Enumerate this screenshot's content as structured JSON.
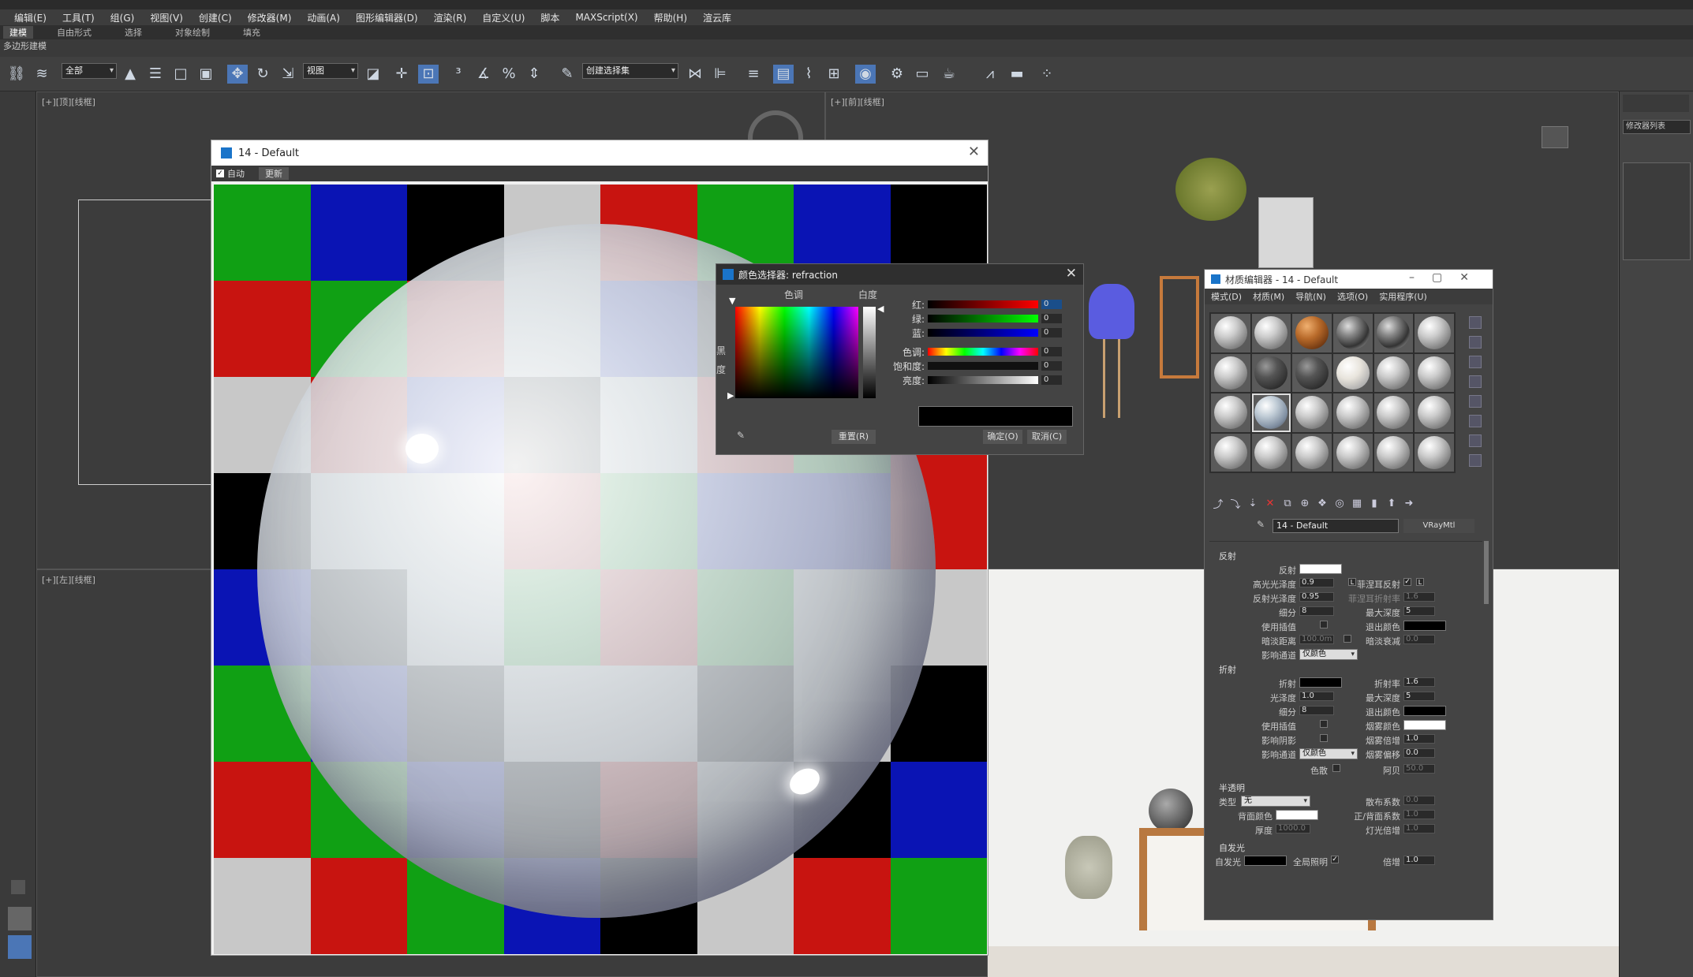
{
  "menu": [
    "编辑(E)",
    "工具(T)",
    "组(G)",
    "视图(V)",
    "创建(C)",
    "修改器(M)",
    "动画(A)",
    "图形编辑器(D)",
    "渲染(R)",
    "自定义(U)",
    "脚本",
    "MAXScript(X)",
    "帮助(H)",
    "渲云库"
  ],
  "ribbon": [
    "建模",
    "自由形式",
    "选择",
    "对象绘制",
    "填充"
  ],
  "ribbon_sub": "多边形建模",
  "toolbar": {
    "select_filter": "全部",
    "coord_system": "视图",
    "selection_set": "创建选择集"
  },
  "viewports": {
    "top_left": "[+][顶][线框]",
    "top_right": "[+][前][线框]",
    "bottom_left": "[+][左][线框]"
  },
  "right_panel": {
    "modifier_list": "修改器列表"
  },
  "material_preview": {
    "title": "14 - Default",
    "auto_label": "自动",
    "update_label": "更新",
    "checker_colors": [
      [
        "#10a014",
        "#0a14b4",
        "#000000",
        "#c8c8c8",
        "#c81410",
        "#10a014",
        "#0a14b4",
        "#000000"
      ],
      [
        "#c81410",
        "#10a014",
        "#c81410",
        "#c8c8c8",
        "#0a14b4",
        "#000000",
        "#c8c8c8",
        "#c81410"
      ],
      [
        "#c8c8c8",
        "#c81410",
        "#0a14b4",
        "#000000",
        "#c8c8c8",
        "#c81410",
        "#10a014",
        "#c81410"
      ],
      [
        "#000000",
        "#c8c8c8",
        "#c8c8c8",
        "#c81410",
        "#10a014",
        "#0a14b4",
        "#0a14b4",
        "#c81410"
      ],
      [
        "#0a14b4",
        "#000000",
        "#c8c8c8",
        "#10a014",
        "#c81410",
        "#10a014",
        "#c8c8c8",
        "#c8c8c8"
      ],
      [
        "#10a014",
        "#0a14b4",
        "#000000",
        "#c8c8c8",
        "#c8c8c8",
        "#000000",
        "#c8c8c8",
        "#000000"
      ],
      [
        "#c81410",
        "#10a014",
        "#0a14b4",
        "#000000",
        "#c81410",
        "#c8c8c8",
        "#000000",
        "#0a14b4"
      ],
      [
        "#c8c8c8",
        "#c81410",
        "#10a014",
        "#0a14b4",
        "#000000",
        "#c8c8c8",
        "#c81410",
        "#10a014"
      ]
    ]
  },
  "color_picker": {
    "title": "颜色选择器: refraction",
    "hue_label": "色调",
    "whiteness_label": "白度",
    "blackness_label": "黑度",
    "red_label": "红:",
    "green_label": "绿:",
    "blue_label": "蓝:",
    "hue2_label": "色调:",
    "saturation_label": "饱和度:",
    "value_label": "亮度:",
    "red": "0",
    "green": "0",
    "blue": "0",
    "hue": "0",
    "saturation": "0",
    "value": "0",
    "reset_label": "重置(R)",
    "ok_label": "确定(O)",
    "cancel_label": "取消(C)",
    "current_color": "#000000"
  },
  "material_editor": {
    "title": "材质编辑器 - 14 - Default",
    "menu": [
      "模式(D)",
      "材质(M)",
      "导航(N)",
      "选项(O)",
      "实用程序(U)"
    ],
    "material_name": "14 - Default",
    "material_type": "VRayMtl",
    "reflection": {
      "section": "反射",
      "reflect_label": "反射",
      "hilight_gloss_label": "高光光泽度",
      "hilight_gloss": "0.9",
      "lock_label": "L",
      "refl_gloss_label": "反射光泽度",
      "refl_gloss": "0.95",
      "subdivs_label": "细分",
      "subdivs": "8",
      "use_interp_label": "使用插值",
      "dim_distance_label": "暗淡距离",
      "dim_distance": "100.0m",
      "affect_channels_label": "影响通道",
      "affect_channels": "仅颜色",
      "fresnel_label": "菲涅耳反射",
      "fresnel_ior_label": "菲涅耳折射率",
      "fresnel_ior": "1.6",
      "max_depth_label": "最大深度",
      "max_depth": "5",
      "exit_color_label": "退出颜色",
      "dim_falloff_label": "暗淡衰减",
      "dim_falloff": "0.0"
    },
    "refraction": {
      "section": "折射",
      "refract_label": "折射",
      "gloss_label": "光泽度",
      "gloss": "1.0",
      "subdivs_label": "细分",
      "subdivs": "8",
      "use_interp_label": "使用插值",
      "affect_shadows_label": "影响阴影",
      "affect_channels_label": "影响通道",
      "affect_channels": "仅颜色",
      "ior_label": "折射率",
      "ior": "1.6",
      "max_depth_label": "最大深度",
      "max_depth": "5",
      "exit_color_label": "退出颜色",
      "fog_color_label": "烟雾颜色",
      "fog_mult_label": "烟雾倍增",
      "fog_mult": "1.0",
      "fog_bias_label": "烟雾偏移",
      "fog_bias": "0.0",
      "dispersion_label": "色散",
      "abbe_label": "阿贝",
      "abbe": "50.0"
    },
    "translucency": {
      "section": "半透明",
      "type_label": "类型",
      "type": "无",
      "back_color_label": "背面颜色",
      "thickness_label": "厚度",
      "thickness": "1000.0",
      "scatter_label": "散布系数",
      "scatter": "0.0",
      "fwd_bck_label": "正/背面系数",
      "fwd_bck": "1.0",
      "light_mult_label": "灯光倍增",
      "light_mult": "1.0"
    },
    "self_illum": {
      "section": "自发光",
      "self_illum_label": "自发光",
      "gi_label": "全局照明",
      "mult_label": "倍增",
      "mult": "1.0"
    }
  }
}
